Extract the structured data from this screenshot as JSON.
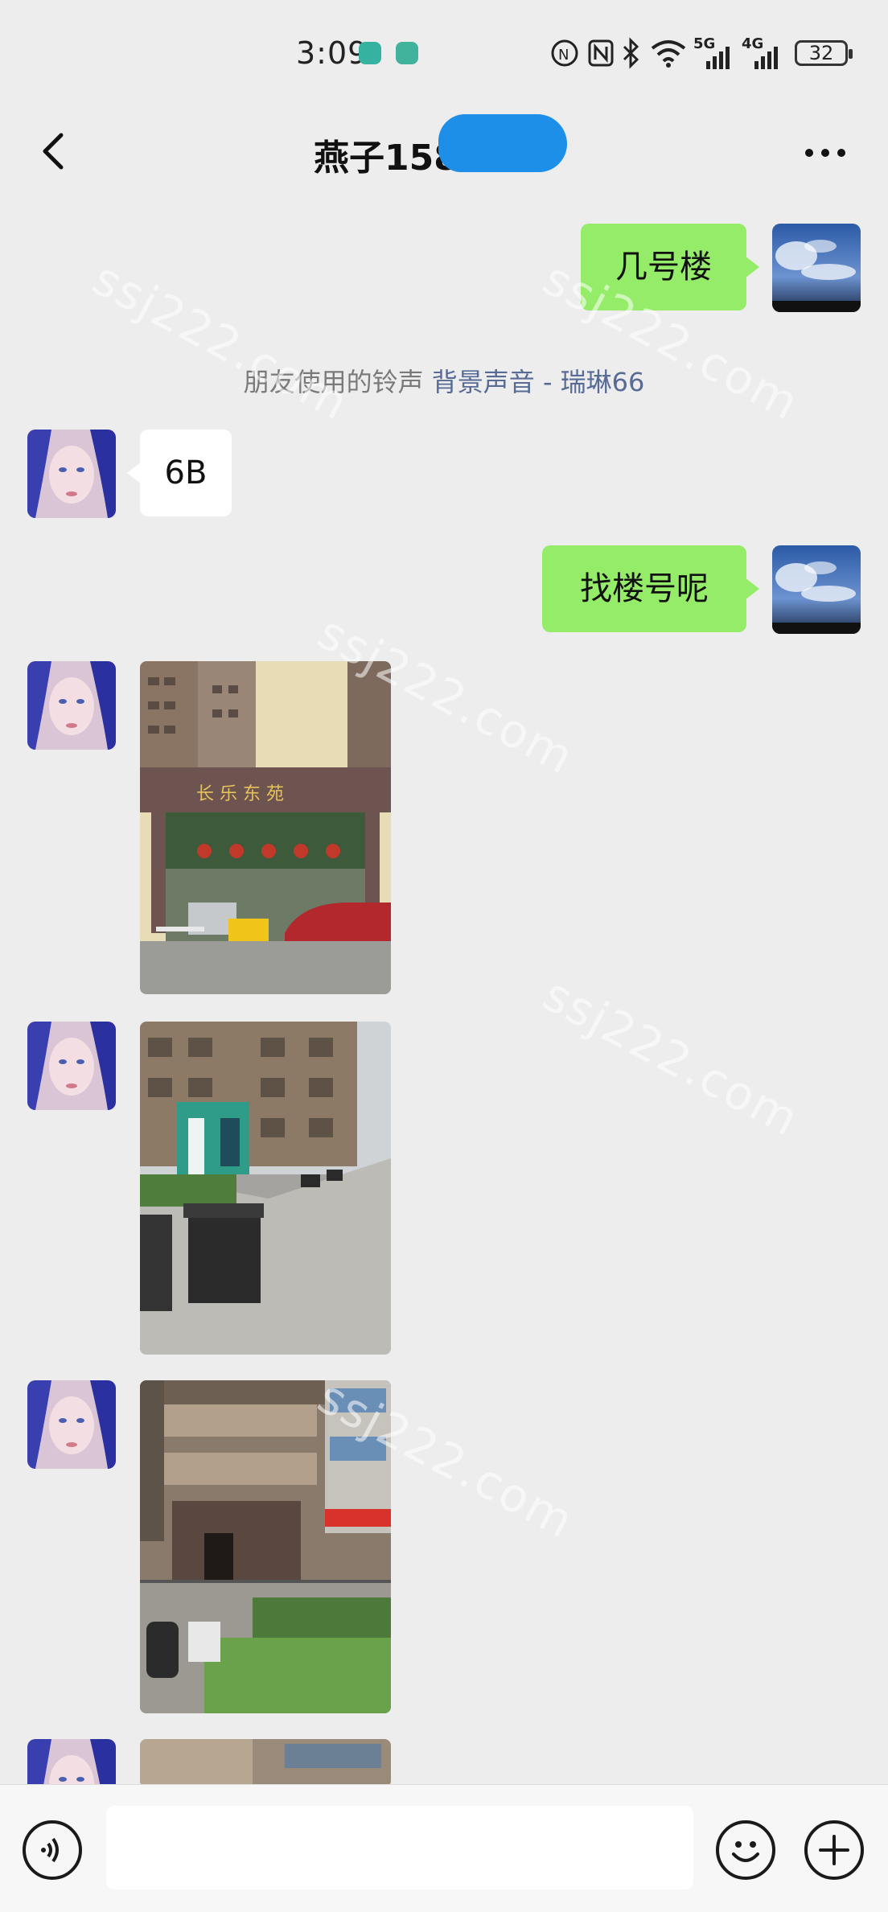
{
  "status_bar": {
    "time": "3:09",
    "battery": "32",
    "network_labels": [
      "5G",
      "4G"
    ]
  },
  "header": {
    "title": "燕子158",
    "icons": [
      "back-chevron-icon",
      "more-dots-icon"
    ]
  },
  "messages": [
    {
      "type": "text",
      "direction": "outgoing",
      "text": "几号楼"
    },
    {
      "type": "system",
      "text": "朋友使用的铃声",
      "link_text": "背景声音 - 瑞琳66"
    },
    {
      "type": "text",
      "direction": "incoming",
      "text": "6B"
    },
    {
      "type": "text",
      "direction": "outgoing",
      "text": "找楼号呢"
    },
    {
      "type": "image",
      "direction": "incoming",
      "sign_text": "长 乐 东 苑"
    },
    {
      "type": "image",
      "direction": "incoming"
    },
    {
      "type": "image",
      "direction": "incoming"
    },
    {
      "type": "image",
      "direction": "incoming"
    }
  ],
  "input_bar": {
    "icons": [
      "voice-icon",
      "emoji-icon",
      "plus-icon"
    ]
  },
  "watermark": "ssj222.com",
  "colors": {
    "background": "#ededed",
    "outgoing_bubble": "#95ec69",
    "incoming_bubble": "#ffffff",
    "system_link": "#576b95"
  }
}
